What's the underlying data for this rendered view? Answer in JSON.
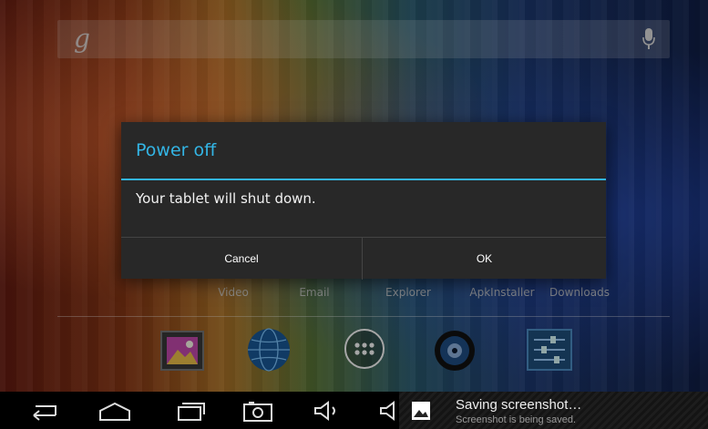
{
  "home": {
    "search": {
      "google_letter": "g"
    },
    "app_labels": [
      "Video",
      "Email",
      "Explorer",
      "ApkInstaller",
      "Downloads"
    ],
    "dock_icons": [
      "gallery-icon",
      "browser-globe-icon",
      "app-drawer-icon",
      "music-speaker-icon",
      "settings-sliders-icon"
    ]
  },
  "dialog": {
    "title": "Power off",
    "message": "Your tablet will shut down.",
    "cancel_label": "Cancel",
    "ok_label": "OK",
    "accent_color": "#33b5e5"
  },
  "navbar": {
    "buttons": [
      "back-icon",
      "home-icon",
      "recent-apps-icon",
      "screenshot-icon",
      "volume-icon",
      "volume-down-icon"
    ]
  },
  "notification": {
    "title": "Saving screenshot…",
    "subtitle": "Screenshot is being saved."
  }
}
